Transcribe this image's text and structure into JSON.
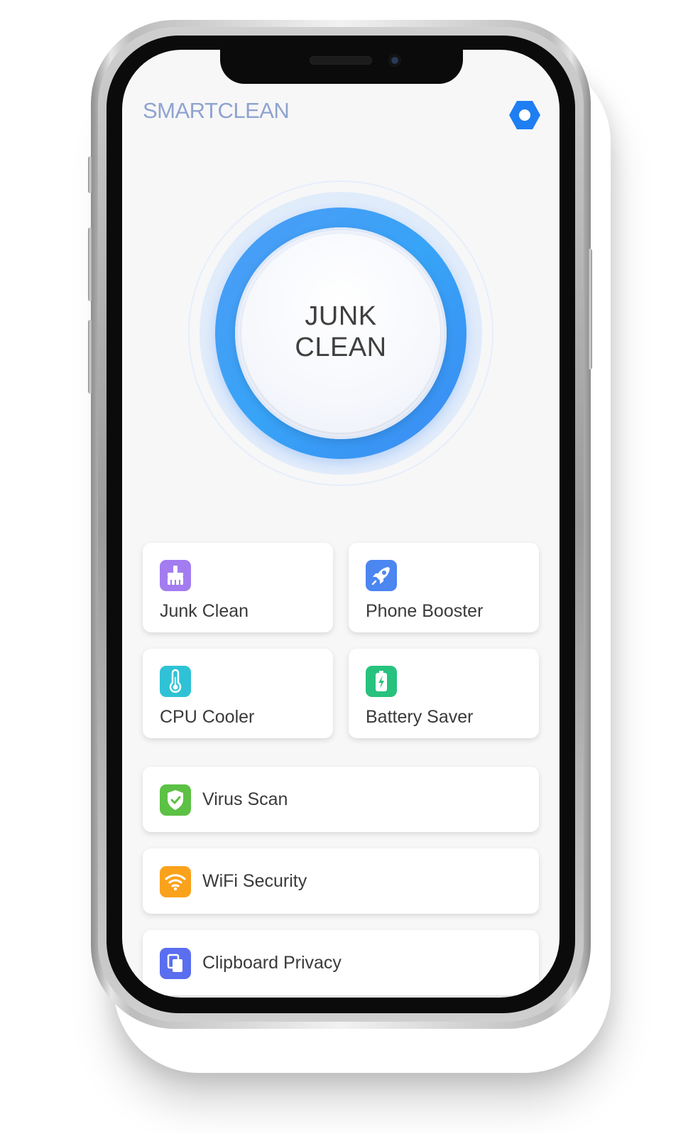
{
  "app": {
    "title": "SMARTCLEAN",
    "settings_icon": "settings-hex-icon",
    "accent": "#1f7ef1"
  },
  "dial": {
    "line1": "JUNK",
    "line2": "CLEAN",
    "ring_color": "#3f9af6"
  },
  "tiles": [
    {
      "label": "Junk Clean",
      "icon": "broom-icon",
      "color": "#a37cf0"
    },
    {
      "label": "Phone Booster",
      "icon": "rocket-icon",
      "color": "#4b86f1"
    },
    {
      "label": "CPU Cooler",
      "icon": "thermometer-icon",
      "color": "#2fc2d6"
    },
    {
      "label": "Battery Saver",
      "icon": "battery-icon",
      "color": "#27c27e"
    }
  ],
  "rows": [
    {
      "label": "Virus Scan",
      "icon": "shield-check-icon",
      "color": "#5cc144"
    },
    {
      "label": "WiFi Security",
      "icon": "wifi-icon",
      "color": "#fba21c"
    },
    {
      "label": "Clipboard Privacy",
      "icon": "clipboard-icon",
      "color": "#5a6ef0"
    }
  ]
}
